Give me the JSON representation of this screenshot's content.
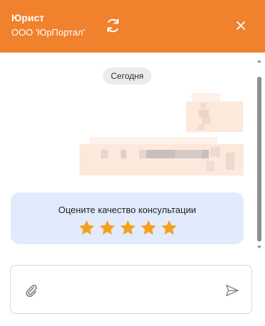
{
  "header": {
    "title": "Юрист",
    "subtitle": "ООО 'ЮрПортал'",
    "background_color": "#f0812d",
    "icons": {
      "refresh": "refresh-icon",
      "close": "close-icon"
    }
  },
  "chat": {
    "date_separator": "Сегодня"
  },
  "rating": {
    "prompt": "Оцените качество консультации",
    "stars_count": 5,
    "star_color": "#f5a020",
    "card_color": "#e2ebfc"
  },
  "composer": {
    "icons": {
      "attach": "paperclip-icon",
      "send": "send-icon"
    }
  }
}
